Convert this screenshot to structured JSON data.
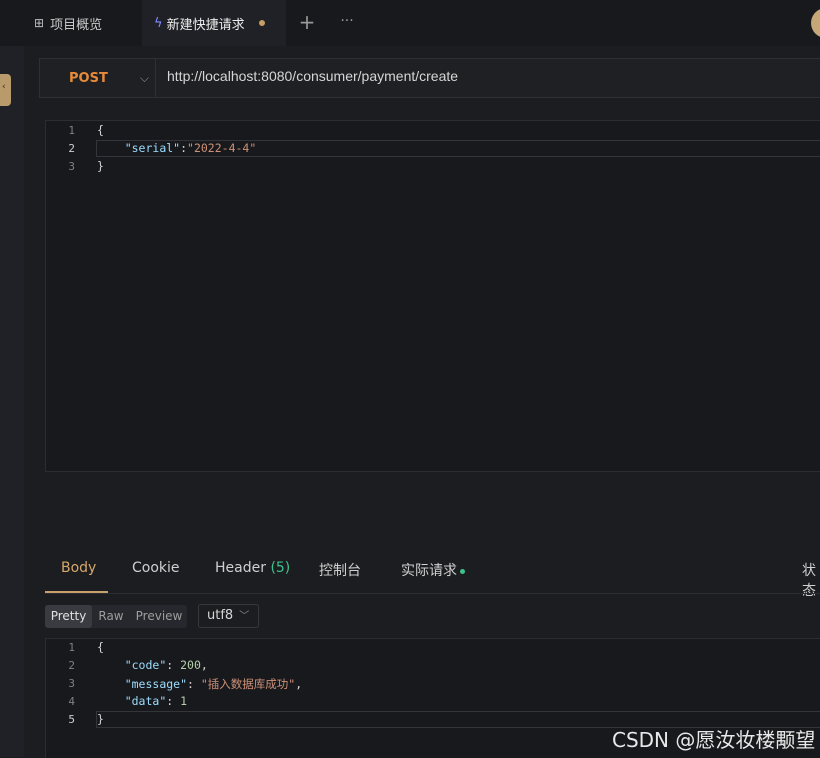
{
  "tabs": {
    "overview_label": "项目概览",
    "request_label": "新建快捷请求"
  },
  "request": {
    "method": "POST",
    "url": "http://localhost:8080/consumer/payment/create",
    "body_lines": [
      "{",
      "    \"serial\":\"2022-4-4\"",
      "}"
    ],
    "body_key": "\"serial\"",
    "body_value": "\"2022-4-4\"",
    "line_numbers": [
      "1",
      "2",
      "3"
    ]
  },
  "response": {
    "tabs": [
      "Body",
      "Cookie",
      "Header",
      "控制台",
      "实际请求"
    ],
    "header_count": "(5)",
    "status_label": "状态",
    "formats": [
      "Pretty",
      "Raw",
      "Preview"
    ],
    "encoding": "utf8",
    "line_numbers": [
      "1",
      "2",
      "3",
      "4",
      "5"
    ],
    "code_key": "\"code\"",
    "code_value": "200",
    "message_key": "\"message\"",
    "message_value": "\"插入数据库成功\"",
    "data_key": "\"data\"",
    "data_value": "1"
  },
  "watermark": "CSDN @愿汝妆楼颙望",
  "colors": {
    "accent": "#c7a06a",
    "method": "#e88b39",
    "key": "#9cdcfe",
    "string": "#ce9178",
    "number": "#b5cea8",
    "status_dot": "#3fc28a"
  }
}
